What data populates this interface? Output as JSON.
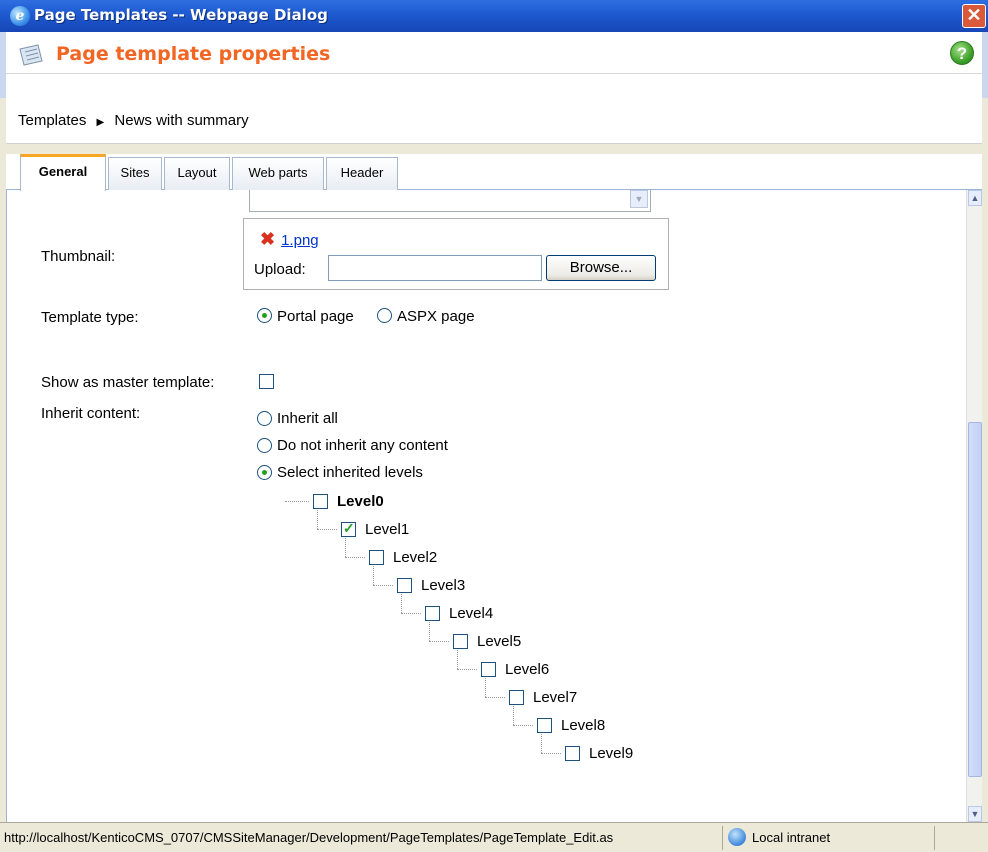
{
  "window": {
    "title": "Page Templates -- Webpage Dialog",
    "close_glyph": "✕",
    "ie_icon": "ie-icon",
    "ie_glyph": "e"
  },
  "header": {
    "title": "Page template properties",
    "help_glyph": "?",
    "title_color": "#F26522"
  },
  "breadcrumb": {
    "items": [
      "Templates",
      "News with summary"
    ],
    "separator": "▶"
  },
  "tabs": [
    {
      "label": "General",
      "active": true
    },
    {
      "label": "Sites",
      "active": false
    },
    {
      "label": "Layout",
      "active": false
    },
    {
      "label": "Web parts",
      "active": false
    },
    {
      "label": "Header",
      "active": false
    }
  ],
  "form": {
    "thumbnail_label": "Thumbnail:",
    "thumbnail_file": "1.png",
    "upload_label": "Upload:",
    "browse_label": "Browse...",
    "template_type_label": "Template type:",
    "template_type_options": [
      "Portal page",
      "ASPX page"
    ],
    "template_type_selected": "Portal page",
    "master_label": "Show as master template:",
    "master_checked": false,
    "inherit_label": "Inherit content:",
    "inherit_options": [
      "Inherit all",
      "Do not inherit any content",
      "Select inherited levels"
    ],
    "inherit_selected": "Select inherited levels",
    "levels": [
      {
        "label": "Level0",
        "checked": false,
        "bold": true
      },
      {
        "label": "Level1",
        "checked": true
      },
      {
        "label": "Level2",
        "checked": false
      },
      {
        "label": "Level3",
        "checked": false
      },
      {
        "label": "Level4",
        "checked": false
      },
      {
        "label": "Level5",
        "checked": false
      },
      {
        "label": "Level6",
        "checked": false
      },
      {
        "label": "Level7",
        "checked": false
      },
      {
        "label": "Level8",
        "checked": false
      },
      {
        "label": "Level9",
        "checked": false
      }
    ]
  },
  "statusbar": {
    "url": "http://localhost/KenticoCMS_0707/CMSSiteManager/Development/PageTemplates/PageTemplate_Edit.as",
    "zone": "Local intranet"
  }
}
